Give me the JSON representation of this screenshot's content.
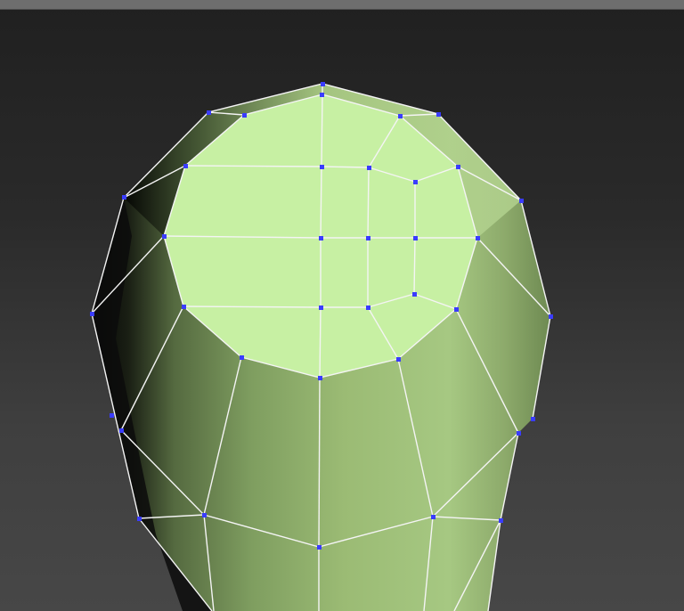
{
  "viewport": {
    "name": "Perspective",
    "background_top": "#202020",
    "background_bottom": "#474747"
  },
  "object": {
    "type": "editable-poly",
    "selection_level": "vertex",
    "top_cap_color": "#c7f0a3",
    "body_color": "#9bbb74",
    "shadow_color": "#0c0c0c",
    "wire_color": "#f4f4f4",
    "vertex_color": "#3a3cff"
  }
}
